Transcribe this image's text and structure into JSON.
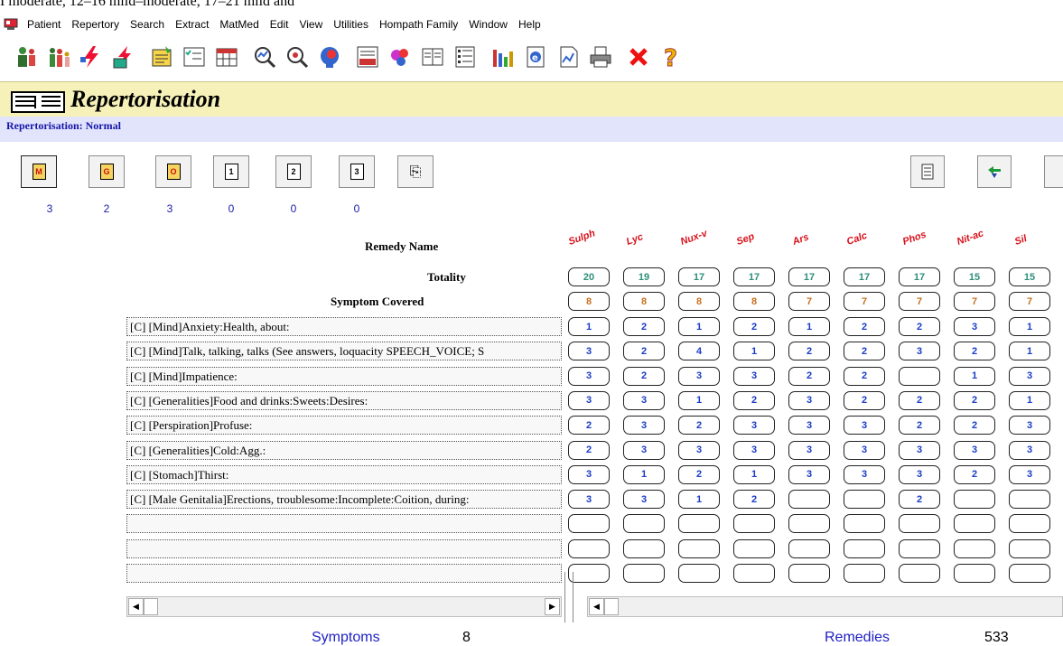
{
  "top_text": "I moderate, 12–16 mild–moderate, 17–21 mild and",
  "menu": [
    "Patient",
    "Repertory",
    "Search",
    "Extract",
    "MatMed",
    "Edit",
    "View",
    "Utilities",
    "Hompath Family",
    "Window",
    "Help"
  ],
  "toolbar_icons": [
    "doctor-icon",
    "family-icon",
    "lightning-icon",
    "lightning-book-icon",
    "notes-icon",
    "checklist-icon",
    "calendar-icon",
    "search-graph-icon",
    "search-zoom-icon",
    "head-icon",
    "rmm-icon",
    "bubbles-icon",
    "book-icon",
    "list-icon",
    "bar-chart-icon",
    "globe-icon",
    "document-icon",
    "printer-icon",
    "close-icon",
    "help-icon"
  ],
  "header": {
    "title": "Repertorisation",
    "subtitle": "Repertorisation: Normal"
  },
  "filters": [
    {
      "letter": "M",
      "count": "3"
    },
    {
      "letter": "G",
      "count": "2"
    },
    {
      "letter": "O",
      "count": "3"
    },
    {
      "letter": "1",
      "count": "0"
    },
    {
      "letter": "2",
      "count": "0"
    },
    {
      "letter": "3",
      "count": "0"
    }
  ],
  "labels": {
    "remedy_name": "Remedy Name",
    "totality": "Totality",
    "symptom_covered": "Symptom Covered"
  },
  "remedies": [
    {
      "name": "Sulph",
      "totality": "20",
      "covered": "8"
    },
    {
      "name": "Lyc",
      "totality": "19",
      "covered": "8"
    },
    {
      "name": "Nux-v",
      "totality": "17",
      "covered": "8"
    },
    {
      "name": "Sep",
      "totality": "17",
      "covered": "8"
    },
    {
      "name": "Ars",
      "totality": "17",
      "covered": "7"
    },
    {
      "name": "Calc",
      "totality": "17",
      "covered": "7"
    },
    {
      "name": "Phos",
      "totality": "17",
      "covered": "7"
    },
    {
      "name": "Nit-ac",
      "totality": "15",
      "covered": "7"
    },
    {
      "name": "Sil",
      "totality": "15",
      "covered": "7"
    }
  ],
  "symptoms": [
    {
      "text": "[C] [Mind]Anxiety:Health, about:",
      "grades": [
        "1",
        "2",
        "1",
        "2",
        "1",
        "2",
        "2",
        "3",
        "1"
      ]
    },
    {
      "text": "[C] [Mind]Talk, talking, talks (See answers, loquacity SPEECH_VOICE; S",
      "grades": [
        "3",
        "2",
        "4",
        "1",
        "2",
        "2",
        "3",
        "2",
        "1"
      ]
    },
    {
      "text": "[C] [Mind]Impatience:",
      "grades": [
        "3",
        "2",
        "3",
        "3",
        "2",
        "2",
        "",
        "1",
        "3"
      ]
    },
    {
      "text": "[C] [Generalities]Food and drinks:Sweets:Desires:",
      "grades": [
        "3",
        "3",
        "1",
        "2",
        "3",
        "2",
        "2",
        "2",
        "1"
      ]
    },
    {
      "text": "[C] [Perspiration]Profuse:",
      "grades": [
        "2",
        "3",
        "2",
        "3",
        "3",
        "3",
        "2",
        "2",
        "3"
      ]
    },
    {
      "text": "[C] [Generalities]Cold:Agg.:",
      "grades": [
        "2",
        "3",
        "3",
        "3",
        "3",
        "3",
        "3",
        "3",
        "3"
      ]
    },
    {
      "text": "[C] [Stomach]Thirst:",
      "grades": [
        "3",
        "1",
        "2",
        "1",
        "3",
        "3",
        "3",
        "2",
        "3"
      ]
    },
    {
      "text": "[C] [Male Genitalia]Erections, troublesome:Incomplete:Coition, during:",
      "grades": [
        "3",
        "3",
        "1",
        "2",
        "",
        "",
        "2",
        "",
        ""
      ]
    },
    {
      "text": "",
      "grades": [
        "",
        "",
        "",
        "",
        "",
        "",
        "",
        "",
        ""
      ]
    },
    {
      "text": "",
      "grades": [
        "",
        "",
        "",
        "",
        "",
        "",
        "",
        "",
        ""
      ]
    },
    {
      "text": "",
      "grades": [
        "",
        "",
        "",
        "",
        "",
        "",
        "",
        "",
        ""
      ]
    }
  ],
  "footer": {
    "symptoms_label": "Symptoms",
    "symptoms_count": "8",
    "remedies_label": "Remedies",
    "remedies_count": "533"
  }
}
